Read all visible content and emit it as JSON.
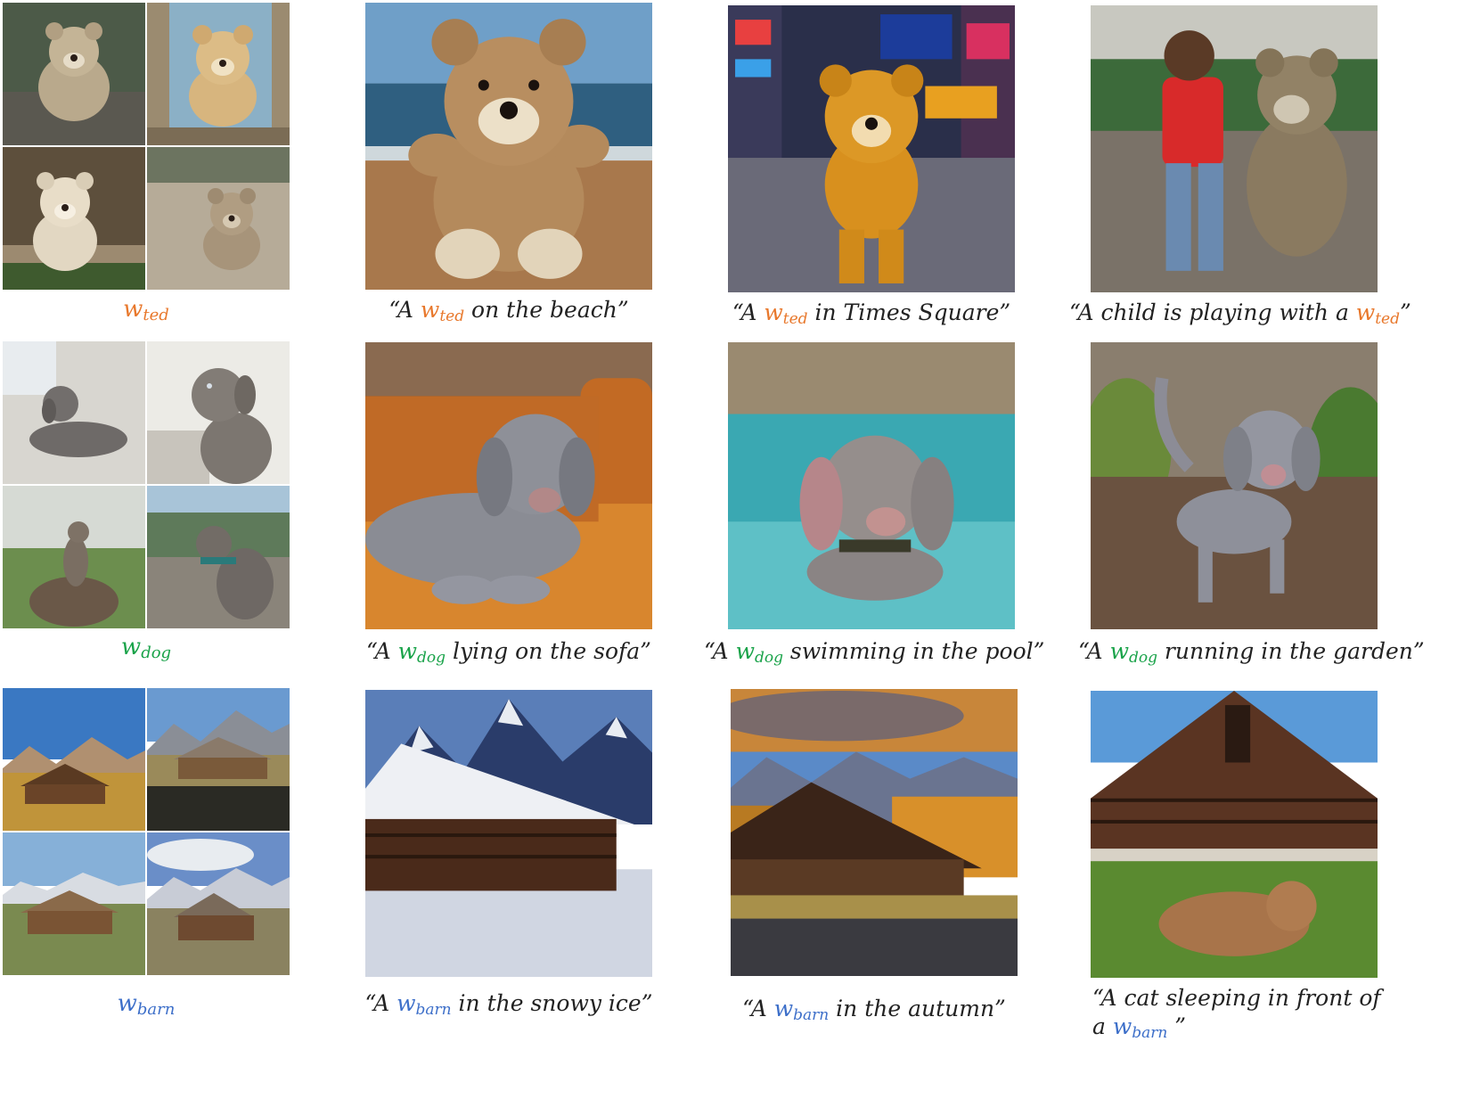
{
  "rows": [
    {
      "concept": "ted",
      "ref_label": {
        "base": "w",
        "sub": "ted"
      },
      "captions": [
        {
          "pre": "“A ",
          "tok": {
            "base": "w",
            "sub": "ted"
          },
          "post": "  on the beach”"
        },
        {
          "pre": "“A ",
          "tok": {
            "base": "w",
            "sub": "ted"
          },
          "post": "  in Times Square”"
        },
        {
          "pre": "“A child is playing with a ",
          "tok": {
            "base": "w",
            "sub": "ted"
          },
          "post": "”"
        }
      ]
    },
    {
      "concept": "dog",
      "ref_label": {
        "base": "w",
        "sub": "dog"
      },
      "captions": [
        {
          "pre": "“A ",
          "tok": {
            "base": "w",
            "sub": "dog"
          },
          "post": " lying on the sofa”"
        },
        {
          "pre": "“A ",
          "tok": {
            "base": "w",
            "sub": "dog"
          },
          "post": " swimming in the pool”"
        },
        {
          "pre": "“A ",
          "tok": {
            "base": "w",
            "sub": "dog"
          },
          "post": " running in the garden”"
        }
      ]
    },
    {
      "concept": "barn",
      "ref_label": {
        "base": "w",
        "sub": "barn"
      },
      "captions": [
        {
          "pre": "“A ",
          "tok": {
            "base": "w",
            "sub": "barn"
          },
          "post": "  in the snowy ice”"
        },
        {
          "pre": "“A ",
          "tok": {
            "base": "w",
            "sub": "barn"
          },
          "post": "  in the autumn”"
        },
        {
          "line1": "“A cat sleeping in front of",
          "pre": "a ",
          "tok": {
            "base": "w",
            "sub": "barn"
          },
          "post": " ”"
        }
      ]
    }
  ],
  "colors": {
    "ted": "#e8782c",
    "dog": "#1aa34a",
    "barn": "#3d6fc9"
  }
}
